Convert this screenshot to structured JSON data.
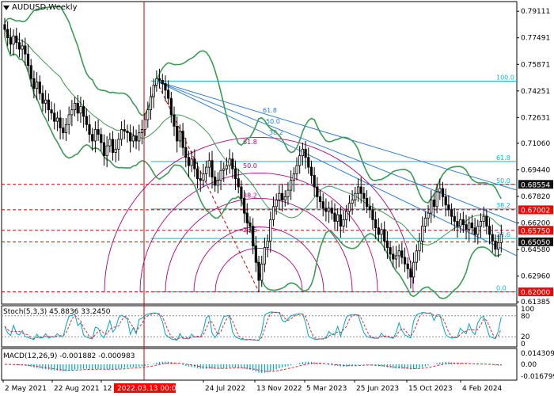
{
  "header": {
    "title": "AUDUSD,Weekly"
  },
  "colors": {
    "candle": "#000000",
    "bollinger": "#3a9b52",
    "fib_line": "#00bcd4",
    "fan_line": "#2e7dd1",
    "red_level": "#cc0000",
    "arc": "#b0007a",
    "stoch_main": "#00a6c8",
    "stoch_signal": "#d32f2f",
    "macd_hist": "#00a6c8",
    "macd_signal": "#d32f2f",
    "tag_red": "#ff0000",
    "tag_dark": "#111111",
    "vline": "#cc0000"
  },
  "price_axis": [
    "0.79111",
    "0.77491",
    "0.75871",
    "0.74251",
    "0.72631",
    "0.71060",
    "0.69440",
    "0.67820",
    "0.66200",
    "0.64580",
    "0.62960",
    "0.61385"
  ],
  "price_tags": [
    {
      "label": "0.68554",
      "style": "dark",
      "price": 0.68554
    },
    {
      "label": "0.67002",
      "style": "red",
      "price": 0.67002
    },
    {
      "label": "0.65750",
      "style": "red",
      "price": 0.6575
    },
    {
      "label": "0.65050",
      "style": "dark",
      "price": 0.6505
    },
    {
      "label": "0.62000",
      "style": "red",
      "price": 0.62
    }
  ],
  "red_levels": [
    0.68554,
    0.67002,
    0.6575,
    0.6505,
    0.62
  ],
  "fib_retracement": [
    {
      "label": "100.0",
      "price": 0.7485
    },
    {
      "label": "61.8",
      "price": 0.6995
    },
    {
      "label": "50.0",
      "price": 0.6855
    },
    {
      "label": "38.2",
      "price": 0.6705
    },
    {
      "label": "23.6",
      "price": 0.6525
    },
    {
      "label": "0.0",
      "price": 0.62
    }
  ],
  "fan_labels": [
    "61.8",
    "50.0",
    "38.2"
  ],
  "arc_labels": [
    "61.8",
    "50.0",
    "38.2",
    "23.6"
  ],
  "date_axis": [
    "2 May 2021",
    "22 Aug 2021",
    "12",
    "24 Jul 2022",
    "13 Nov 2022",
    "5 Mar 2023",
    "25 Jun 2023",
    "15 Oct 2023",
    "4 Feb 2024"
  ],
  "date_highlight": "2022.03.13 00:00",
  "stoch": {
    "label": "Stoch(5,3,3) 45.8836 33.2450",
    "axis": [
      "100",
      "80",
      "20",
      "0"
    ]
  },
  "macd": {
    "label": "MACD(12,26,9) -0.001882 -0.000983",
    "axis": [
      "0.014309",
      "0.00",
      "-0.016799"
    ]
  },
  "chart_data": {
    "type": "candlestick",
    "title": "AUDUSD,Weekly",
    "ylim": [
      0.6125,
      0.797
    ],
    "closes": [
      0.78,
      0.775,
      0.771,
      0.776,
      0.772,
      0.768,
      0.77,
      0.765,
      0.758,
      0.75,
      0.744,
      0.748,
      0.741,
      0.735,
      0.737,
      0.731,
      0.729,
      0.724,
      0.726,
      0.72,
      0.717,
      0.722,
      0.728,
      0.731,
      0.735,
      0.729,
      0.733,
      0.727,
      0.722,
      0.716,
      0.712,
      0.719,
      0.716,
      0.711,
      0.703,
      0.709,
      0.713,
      0.705,
      0.707,
      0.713,
      0.719,
      0.718,
      0.717,
      0.712,
      0.715,
      0.712,
      0.717,
      0.719,
      0.725,
      0.731,
      0.739,
      0.746,
      0.75,
      0.749,
      0.747,
      0.743,
      0.738,
      0.728,
      0.721,
      0.712,
      0.718,
      0.708,
      0.702,
      0.697,
      0.701,
      0.695,
      0.689,
      0.688,
      0.692,
      0.696,
      0.7,
      0.69,
      0.685,
      0.688,
      0.694,
      0.695,
      0.697,
      0.701,
      0.695,
      0.689,
      0.684,
      0.677,
      0.668,
      0.662,
      0.66,
      0.648,
      0.638,
      0.627,
      0.637,
      0.647,
      0.651,
      0.664,
      0.672,
      0.676,
      0.68,
      0.676,
      0.678,
      0.682,
      0.688,
      0.692,
      0.697,
      0.703,
      0.707,
      0.702,
      0.696,
      0.691,
      0.684,
      0.678,
      0.675,
      0.671,
      0.669,
      0.671,
      0.668,
      0.663,
      0.667,
      0.66,
      0.664,
      0.669,
      0.674,
      0.676,
      0.68,
      0.684,
      0.68,
      0.677,
      0.672,
      0.67,
      0.664,
      0.659,
      0.655,
      0.658,
      0.651,
      0.647,
      0.643,
      0.64,
      0.642,
      0.645,
      0.641,
      0.637,
      0.634,
      0.629,
      0.638,
      0.645,
      0.651,
      0.66,
      0.665,
      0.668,
      0.676,
      0.672,
      0.681,
      0.683,
      0.678,
      0.673,
      0.67,
      0.666,
      0.663,
      0.66,
      0.664,
      0.661,
      0.658,
      0.662,
      0.659,
      0.655,
      0.66,
      0.663,
      0.666,
      0.66,
      0.655,
      0.651,
      0.646,
      0.65,
      0.655
    ]
  }
}
